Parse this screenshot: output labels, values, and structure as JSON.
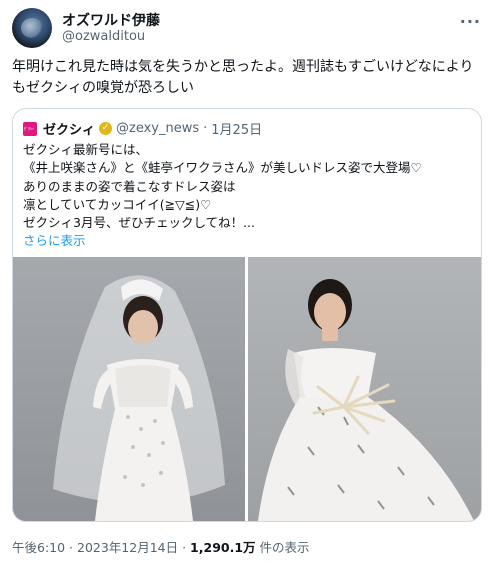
{
  "author": {
    "name": "オズワルド伊藤",
    "handle": "@ozwalditou"
  },
  "tweet": {
    "text": "年明けこれ見た時は気を失うかと思ったよ。週刊誌もすごいけどなによりもゼクシィの嗅覚が恐ろしい"
  },
  "quoted": {
    "name": "ゼクシィ",
    "handle": "@zexy_news",
    "date": "1月25日",
    "lines": [
      "ゼクシィ最新号には、",
      "《井上咲楽さん》と《蛙亭イワクラさん》が美しいドレス姿で大登場♡",
      "ありのままの姿で着こなすドレス姿は",
      "凛としていてカッコイイ(≧▽≦)♡",
      "ゼクシィ3月号、ぜひチェックしてね！..."
    ],
    "show_more": "さらに表示"
  },
  "footer": {
    "time": "午後6:10 · 2023年12月14日 · ",
    "views_count": "1,290.1万",
    "views_label": " 件の表示"
  },
  "icons": {
    "more": "more-horizontal-icon",
    "verified": "verified-badge-icon"
  },
  "colors": {
    "link": "#1d9bf0",
    "secondary_text": "#536471",
    "verified_gold": "#e2b719",
    "brand_pink": "#e0177f"
  }
}
